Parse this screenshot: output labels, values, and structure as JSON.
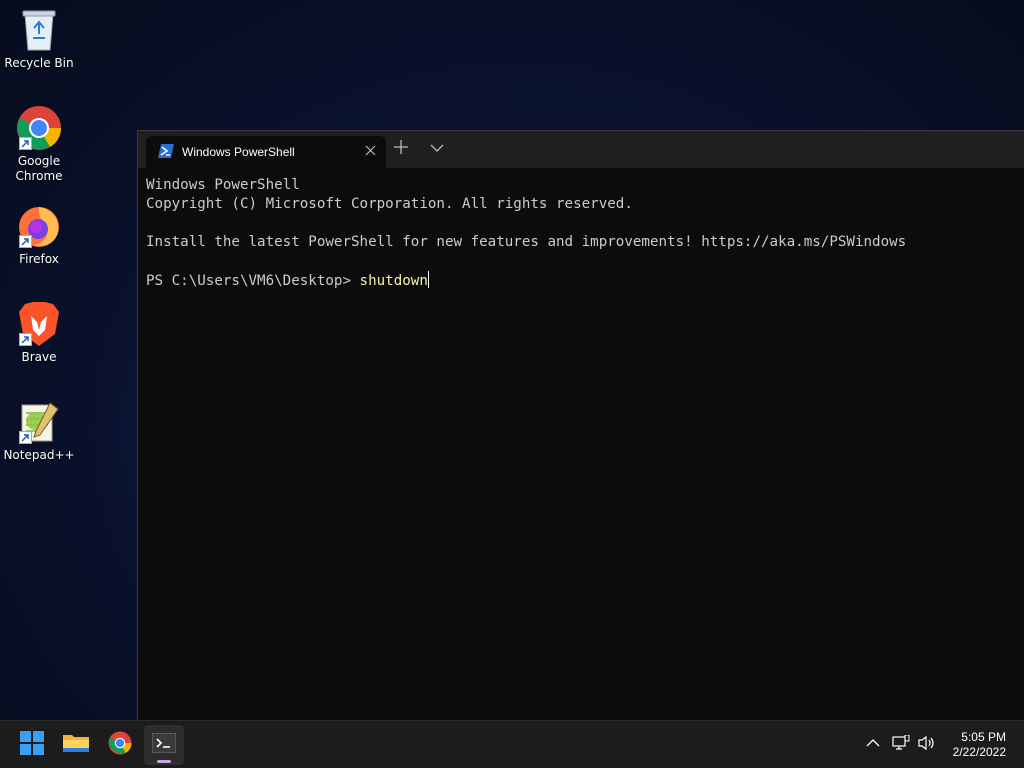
{
  "desktop": {
    "icons": [
      {
        "label": "Recycle Bin"
      },
      {
        "label": "Google Chrome"
      },
      {
        "label": "Firefox"
      },
      {
        "label": "Brave"
      },
      {
        "label": "Notepad++"
      }
    ]
  },
  "terminal": {
    "tab_title": "Windows PowerShell",
    "lines": [
      "Windows PowerShell",
      "Copyright (C) Microsoft Corporation. All rights reserved.",
      "",
      "Install the latest PowerShell for new features and improvements! https://aka.ms/PSWindows",
      ""
    ],
    "prompt": "PS C:\\Users\\VM6\\Desktop> ",
    "command": "shutdown"
  },
  "taskbar": {
    "apps": [
      {
        "name": "windows-start-icon"
      },
      {
        "name": "file-explorer-icon"
      },
      {
        "name": "chrome-icon"
      },
      {
        "name": "terminal-icon",
        "active": true
      }
    ],
    "tray": {
      "time": "5:05 PM",
      "date": "2/22/2022"
    }
  },
  "colors": {
    "terminal_bg": "#0c0c0c",
    "terminal_text": "#cccccc",
    "command_text": "#f9f1a5",
    "taskbar_bg": "#1c1c1c"
  }
}
